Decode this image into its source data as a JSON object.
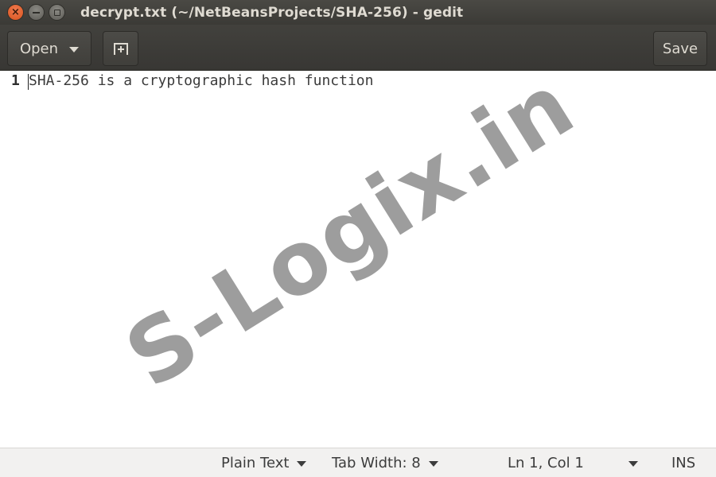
{
  "window": {
    "title": "decrypt.txt (~/NetBeansProjects/SHA-256) - gedit",
    "close_icon": "×",
    "accent_close": "#e65b26"
  },
  "toolbar": {
    "open_label": "Open",
    "new_tab_icon": "new-tab-icon",
    "save_label": "Save"
  },
  "editor": {
    "lines": [
      {
        "number": "1",
        "text": "SHA-256 is a cryptographic hash function"
      }
    ]
  },
  "watermark": "S-Logix.in",
  "statusbar": {
    "language": "Plain Text",
    "tab_width": "Tab Width: 8",
    "position": "Ln 1, Col 1",
    "mode": "INS"
  }
}
